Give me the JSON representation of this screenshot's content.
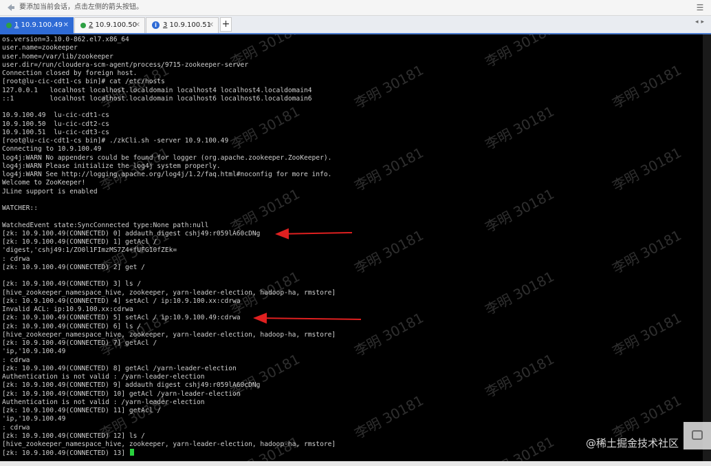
{
  "hint_bar": {
    "text": "要添加当前会话，点击左侧的箭头按钮。",
    "icon": "arrow-icon",
    "menu_icon": "menu-icon"
  },
  "tabs": [
    {
      "index": "1",
      "label": " 10.9.100.49",
      "status": "connected",
      "active": true
    },
    {
      "index": "2",
      "label": " 10.9.100.50",
      "status": "connected",
      "active": false
    },
    {
      "index": "3",
      "label": " 10.9.100.51",
      "status": "info",
      "active": false
    }
  ],
  "new_tab_label": "+",
  "terminal": {
    "lines": [
      "os.version=3.10.0-862.el7.x86_64",
      "user.name=zookeeper",
      "user.home=/var/lib/zookeeper",
      "user.dir=/run/cloudera-scm-agent/process/9715-zookeeper-server",
      "Connection closed by foreign host.",
      "[root@lu-cic-cdt1-cs bin]# cat /etc/hosts",
      "127.0.0.1   localhost localhost.localdomain localhost4 localhost4.localdomain4",
      "::1         localhost localhost.localdomain localhost6 localhost6.localdomain6",
      "",
      "10.9.100.49  lu-cic-cdt1-cs",
      "10.9.100.50  lu-cic-cdt2-cs",
      "10.9.100.51  lu-cic-cdt3-cs",
      "[root@lu-cic-cdt1-cs bin]# ./zkCli.sh -server 10.9.100.49",
      "Connecting to 10.9.100.49",
      "log4j:WARN No appenders could be found for logger (org.apache.zookeeper.ZooKeeper).",
      "log4j:WARN Please initialize the log4j system properly.",
      "log4j:WARN See http://logging.apache.org/log4j/1.2/faq.html#noconfig for more info.",
      "Welcome to ZooKeeper!",
      "JLine support is enabled",
      "",
      "WATCHER::",
      "",
      "WatchedEvent state:SyncConnected type:None path:null",
      "[zk: 10.9.100.49(CONNECTED) 0] addauth digest cshj49:r059lA60cDNg",
      "[zk: 10.9.100.49(CONNECTED) 1] getAcl /",
      "'digest,'cshj49:1/ZO0l1FImzMS7Z4+fUFG10fZEk=",
      ": cdrwa",
      "[zk: 10.9.100.49(CONNECTED) 2] get /",
      "",
      "[zk: 10.9.100.49(CONNECTED) 3] ls /",
      "[hive_zookeeper_namespace_hive, zookeeper, yarn-leader-election, hadoop-ha, rmstore]",
      "[zk: 10.9.100.49(CONNECTED) 4] setAcl / ip:10.9.100.xx:cdrwa",
      "Invalid ACL: ip:10.9.100.xx:cdrwa",
      "[zk: 10.9.100.49(CONNECTED) 5] setAcl / ip:10.9.100.49:cdrwa",
      "[zk: 10.9.100.49(CONNECTED) 6] ls /",
      "[hive_zookeeper_namespace_hive, zookeeper, yarn-leader-election, hadoop-ha, rmstore]",
      "[zk: 10.9.100.49(CONNECTED) 7] getAcl /",
      "'ip,'10.9.100.49",
      ": cdrwa",
      "[zk: 10.9.100.49(CONNECTED) 8] getAcl /yarn-leader-election",
      "Authentication is not valid : /yarn-leader-election",
      "[zk: 10.9.100.49(CONNECTED) 9] addauth digest cshj49:r059lA60cDNg",
      "[zk: 10.9.100.49(CONNECTED) 10] getAcl /yarn-leader-election",
      "Authentication is not valid : /yarn-leader-election",
      "[zk: 10.9.100.49(CONNECTED) 11] getAcl /",
      "'ip,'10.9.100.49",
      ": cdrwa",
      "[zk: 10.9.100.49(CONNECTED) 12] ls /",
      "[hive_zookeeper_namespace_hive, zookeeper, yarn-leader-election, hadoop-ha, rmstore]",
      "[zk: 10.9.100.49(CONNECTED) 13] "
    ],
    "cursor_color": "#29d13d"
  },
  "watermark_text": "李明 30181",
  "site_watermark": "@稀土掘金技术社区",
  "colors": {
    "active_tab": "#2f6bd5",
    "connected_dot": "#2ea043",
    "annotation_arrow": "#e02020"
  }
}
